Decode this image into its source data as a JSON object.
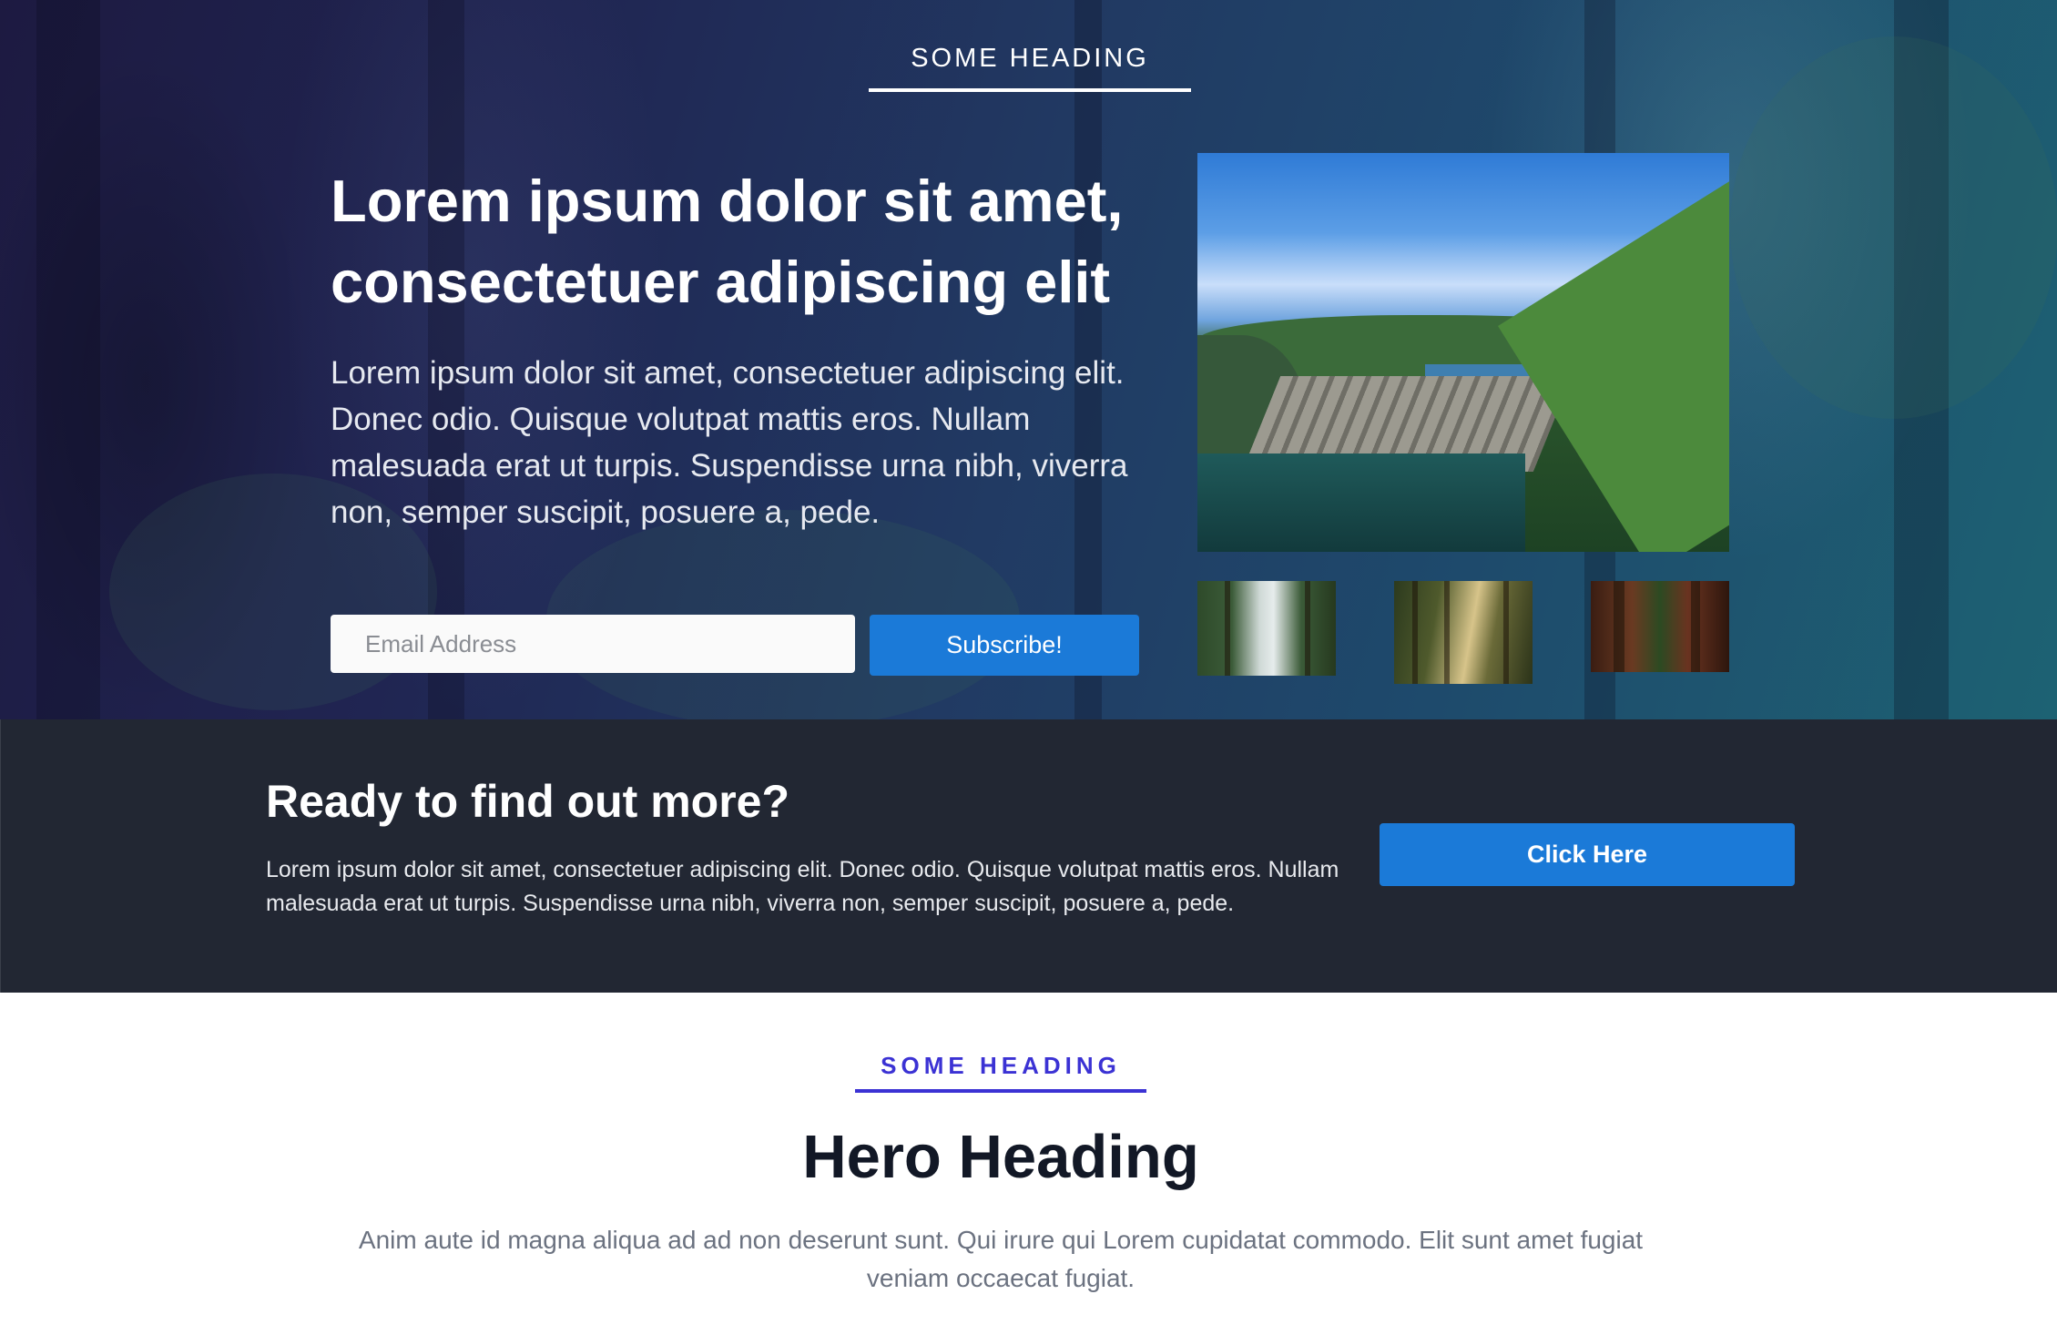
{
  "hero": {
    "kicker": "SOME HEADING",
    "title": "Lorem ipsum dolor sit amet, consectetuer adipiscing elit",
    "text": "Lorem ipsum dolor sit amet, consectetuer adipiscing elit. Donec odio. Quisque volutpat mattis eros. Nullam malesuada erat ut turpis. Suspendisse urna nibh, viverra non, semper suscipit, posuere a, pede.",
    "email_placeholder": "Email Address",
    "subscribe_label": "Subscribe!",
    "gallery": {
      "main_image": "dam-landscape-photo",
      "thumbnails": [
        "forest-river-thumb",
        "sunlit-forest-thumb",
        "red-forest-path-thumb"
      ]
    }
  },
  "cta": {
    "title": "Ready to find out more?",
    "text": "Lorem ipsum dolor sit amet, consectetuer adipiscing elit. Donec odio. Quisque volutpat mattis eros. Nullam malesuada erat ut turpis. Suspendisse urna nibh, viverra non, semper suscipit, posuere a, pede.",
    "button_label": "Click Here"
  },
  "lower": {
    "kicker": "SOME HEADING",
    "title": "Hero Heading",
    "text": "Anim aute id magna aliqua ad ad non deserunt sunt. Qui irure qui Lorem cupidatat commodo. Elit sunt amet fugiat veniam occaecat fugiat."
  },
  "colors": {
    "accent_blue": "#1b7ad8",
    "kicker_purple": "#3b32d4",
    "cta_background": "#222733",
    "heading_dark": "#121826",
    "body_gray": "#6b7280"
  }
}
